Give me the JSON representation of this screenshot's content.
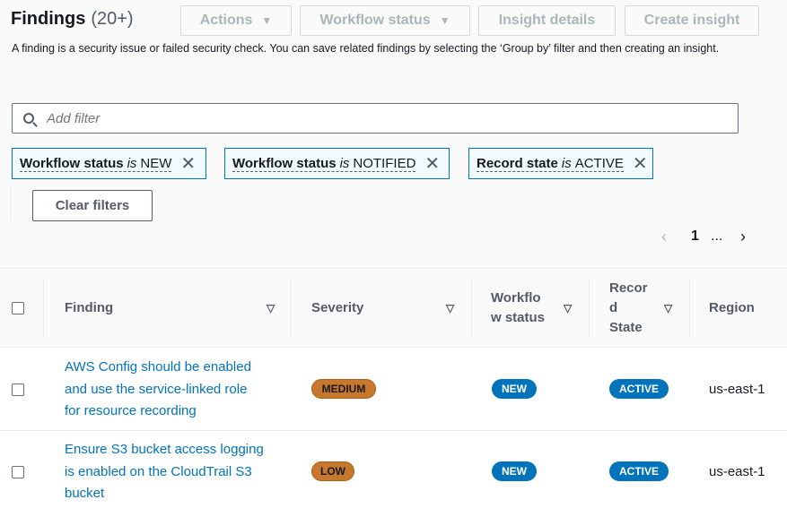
{
  "header": {
    "title": "Findings",
    "count": "(20+)"
  },
  "toolbar": {
    "actions": "Actions",
    "workflow_status": "Workflow status",
    "insight_details": "Insight details",
    "create_insight": "Create insight"
  },
  "description": "A finding is a security issue or failed security check. You can save related findings by selecting the ‘Group by’ filter and then creating an insight.",
  "filter": {
    "placeholder": "Add filter"
  },
  "tokens": [
    {
      "field": "Workflow status",
      "op": "is",
      "value": "NEW"
    },
    {
      "field": "Workflow status",
      "op": "is",
      "value": "NOTIFIED"
    },
    {
      "field": "Record state",
      "op": "is",
      "value": "ACTIVE"
    }
  ],
  "clear_filters": "Clear filters",
  "pagination": {
    "page": "1",
    "more": "..."
  },
  "table": {
    "columns": {
      "finding": "Finding",
      "severity": "Severity",
      "workflow": [
        "Workflo",
        "w status"
      ],
      "record": [
        "Recor",
        "d",
        "State"
      ],
      "region": "Region"
    },
    "rows": [
      {
        "finding": [
          "AWS Config should be enabled",
          "and use the service-linked role",
          "for resource recording"
        ],
        "severity": "MEDIUM",
        "workflow": "NEW",
        "record": "ACTIVE",
        "region": "us-east-1"
      },
      {
        "finding": [
          "Ensure S3 bucket access logging",
          "is enabled on the CloudTrail S3",
          "bucket"
        ],
        "severity": "LOW",
        "workflow": "NEW",
        "record": "ACTIVE",
        "region": "us-east-1"
      }
    ]
  },
  "colors": {
    "accent": "#0073bb",
    "severity_badge": "#c7782c"
  },
  "icons": [
    "search-icon",
    "close-icon",
    "caret-down-icon",
    "chevron-left-icon",
    "chevron-right-icon",
    "sort-icon"
  ]
}
